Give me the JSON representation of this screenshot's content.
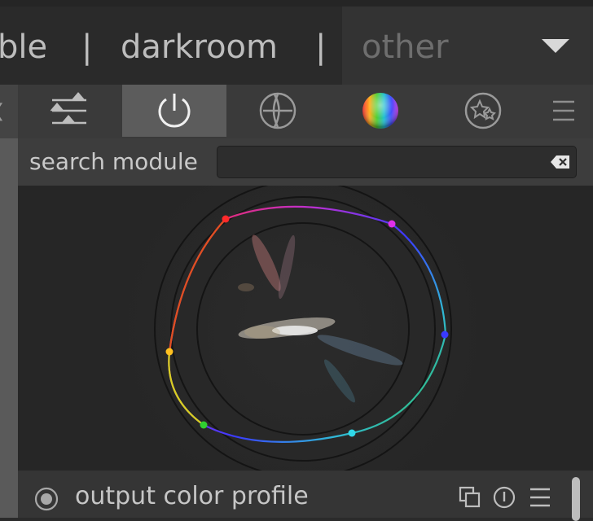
{
  "header": {
    "views": [
      {
        "label": "ble"
      },
      {
        "label": "darkroom"
      },
      {
        "label": "other"
      }
    ],
    "separator": "|"
  },
  "module_groups": {
    "tabs": [
      {
        "icon": "sliders-icon",
        "active": false
      },
      {
        "icon": "power-icon",
        "active": true
      },
      {
        "icon": "lens-icon",
        "active": false
      },
      {
        "icon": "color-sphere-icon",
        "active": false
      },
      {
        "icon": "stars-icon",
        "active": false
      },
      {
        "icon": "hamburger-menu-icon",
        "active": false
      }
    ]
  },
  "search": {
    "label": "search module",
    "value": "",
    "placeholder": ""
  },
  "vectorscope": {
    "hue_points": [
      {
        "hue": "red",
        "color": "#ff2a2a"
      },
      {
        "hue": "magenta",
        "color": "#e030e8"
      },
      {
        "hue": "blue",
        "color": "#3a3aff"
      },
      {
        "hue": "cyan",
        "color": "#30d8e8"
      },
      {
        "hue": "green",
        "color": "#30d030"
      },
      {
        "hue": "yellow",
        "color": "#ffc020"
      }
    ]
  },
  "module": {
    "name": "output color profile",
    "icons": [
      "presets-icon",
      "reset-icon",
      "module-menu-icon"
    ]
  }
}
